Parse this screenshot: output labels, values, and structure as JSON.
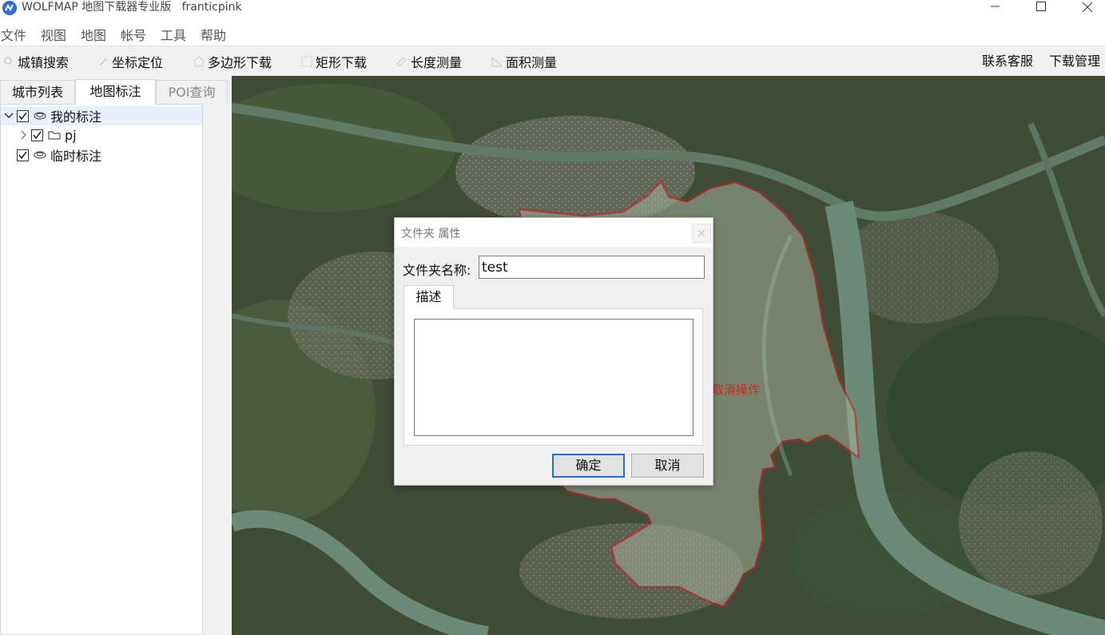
{
  "window": {
    "title": "WOLFMAP 地图下载器专业版   franticpink"
  },
  "menu": [
    "文件",
    "视图",
    "地图",
    "帐号",
    "工具",
    "帮助"
  ],
  "toolbar": {
    "tools": [
      {
        "label": "城镇搜索",
        "icon": "search-icon"
      },
      {
        "label": "坐标定位",
        "icon": "pin-icon"
      },
      {
        "label": "多边形下载",
        "icon": "polygon-icon"
      },
      {
        "label": "矩形下载",
        "icon": "rectangle-icon"
      },
      {
        "label": "长度测量",
        "icon": "ruler-icon"
      },
      {
        "label": "面积测量",
        "icon": "area-icon"
      }
    ],
    "right": [
      "联系客服",
      "下载管理"
    ]
  },
  "left_panel": {
    "tabs": [
      {
        "label": "城市列表",
        "state": "normal"
      },
      {
        "label": "地图标注",
        "state": "active"
      },
      {
        "label": "POI查询",
        "state": "disabled"
      }
    ],
    "tree": [
      {
        "label": "我的标注",
        "checked": true,
        "expanded": true,
        "icon": "layer-icon",
        "selected": true
      },
      {
        "label": "pj",
        "checked": true,
        "expanded": false,
        "icon": "folder-icon",
        "selected": false
      },
      {
        "label": "临时标注",
        "checked": true,
        "expanded": false,
        "icon": "layer-icon",
        "selected": false
      }
    ]
  },
  "map": {
    "overlay_text": "取消操作",
    "boundary_color": "#e01b1b"
  },
  "dialog": {
    "title": "文件夹 属性",
    "name_label": "文件夹名称:",
    "name_value": "test",
    "desc_tab": "描述",
    "desc_value": "",
    "ok_label": "确定",
    "cancel_label": "取消"
  }
}
